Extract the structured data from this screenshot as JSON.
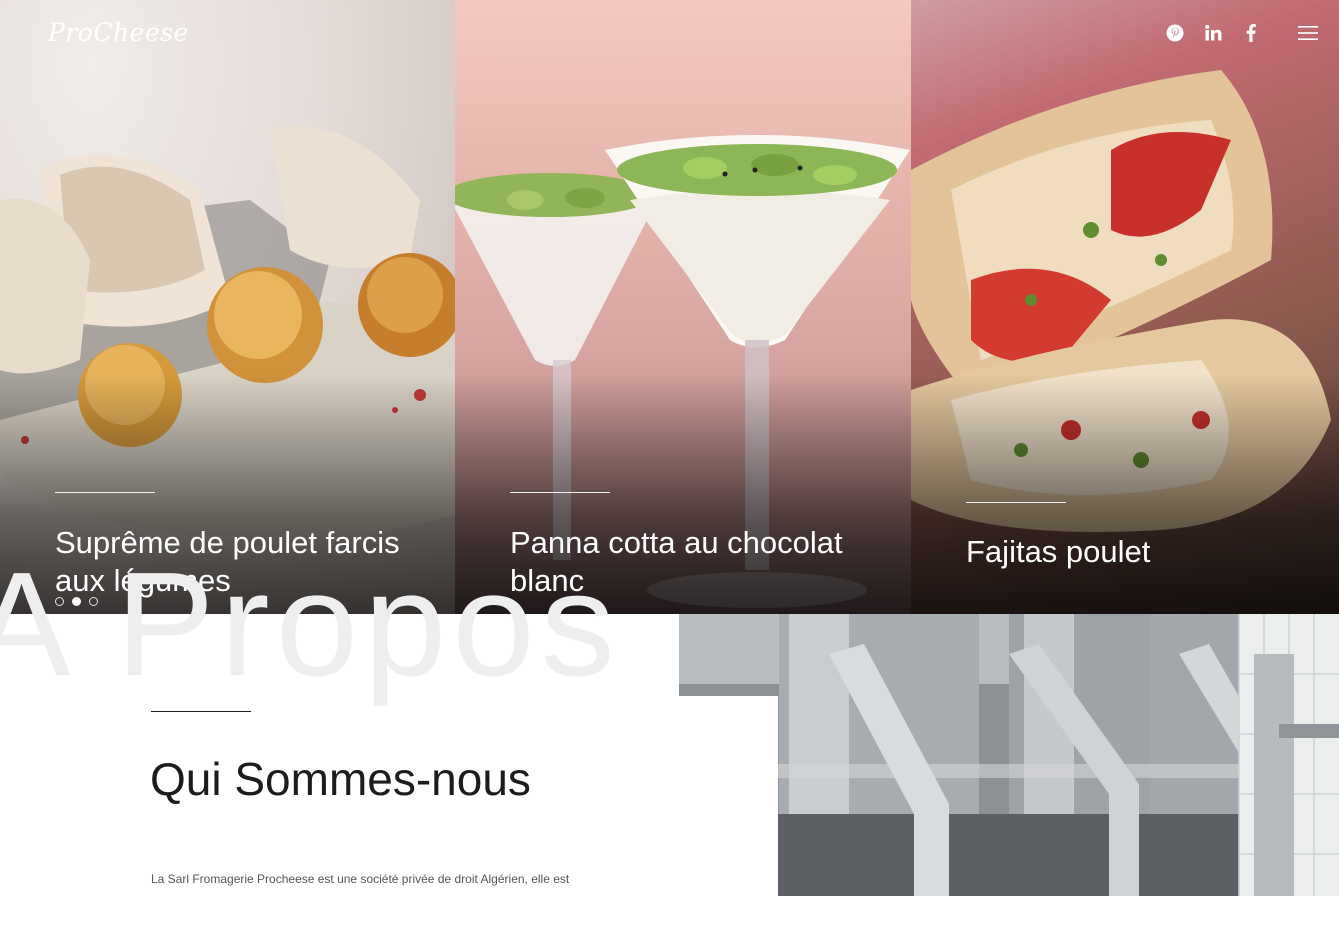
{
  "header": {
    "logo": "ProCheese",
    "social": [
      {
        "icon": "pinterest-icon"
      },
      {
        "icon": "linkedin-icon"
      },
      {
        "icon": "facebook-icon"
      }
    ],
    "menu_icon": "hamburger-menu-icon"
  },
  "slider": {
    "slides": [
      {
        "caption": "Suprême de poulet farcis aux légumes"
      },
      {
        "caption": "Panna cotta au chocolat blanc"
      },
      {
        "caption": "Fajitas poulet"
      }
    ],
    "active_index": 1,
    "dot_count": 3
  },
  "about": {
    "ghost_heading": "A Propos",
    "title": "Qui Sommes-nous",
    "intro": "La Sarl Fromagerie Procheese est une société privée de droit Algérien, elle est"
  }
}
